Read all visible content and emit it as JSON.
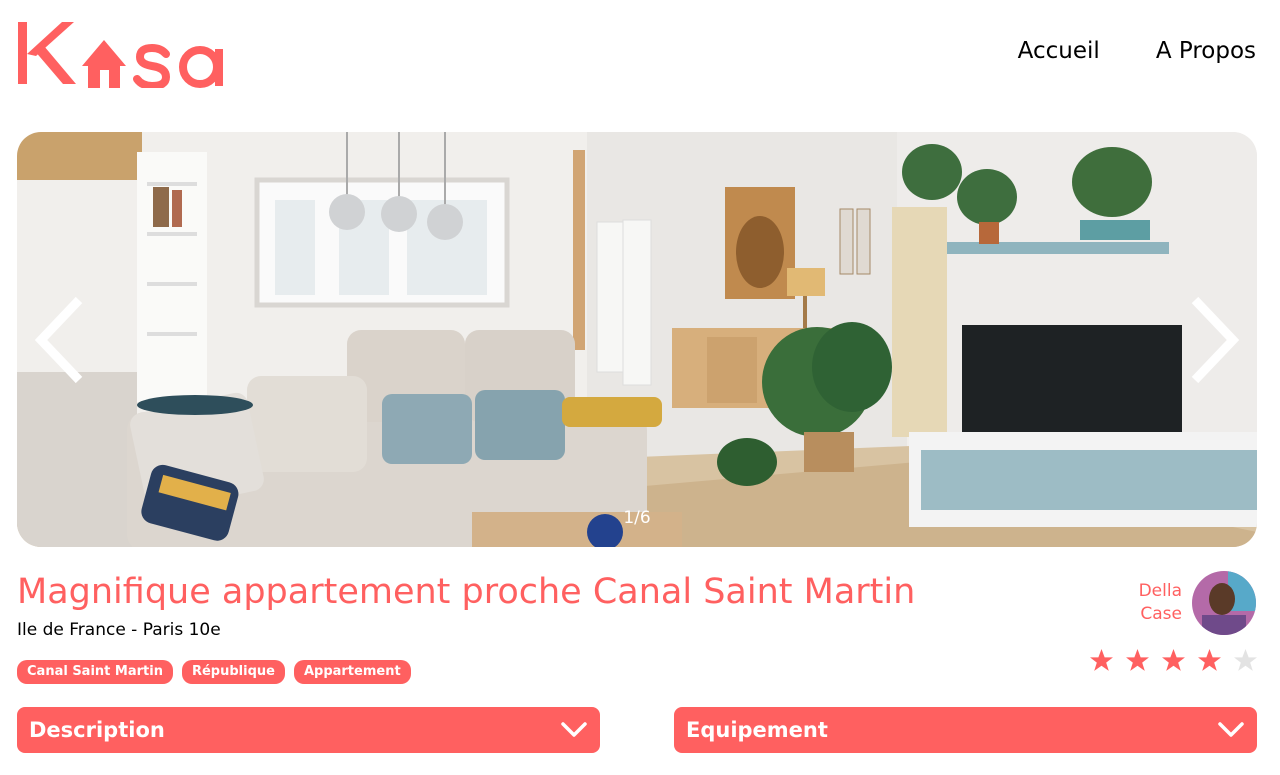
{
  "brand": {
    "logo_text": "K  sa",
    "accent": "#FF6060"
  },
  "nav": {
    "home": "Accueil",
    "about": "A Propos"
  },
  "gallery": {
    "counter": "1/6",
    "prev_icon": "chevron-left-icon",
    "next_icon": "chevron-right-icon"
  },
  "listing": {
    "title": "Magnifique appartement proche Canal Saint Martin",
    "location": "Ile de France - Paris 10e",
    "tags": [
      "Canal Saint Martin",
      "République",
      "Appartement"
    ],
    "rating": 4,
    "rating_max": 5
  },
  "host": {
    "first_name": "Della",
    "last_name": "Case"
  },
  "collapses": {
    "description": "Description",
    "equipment": "Equipement"
  },
  "colors": {
    "accent": "#FF6060",
    "star_inactive": "#E3E3E3",
    "text": "#000000",
    "background": "#FFFFFF"
  }
}
